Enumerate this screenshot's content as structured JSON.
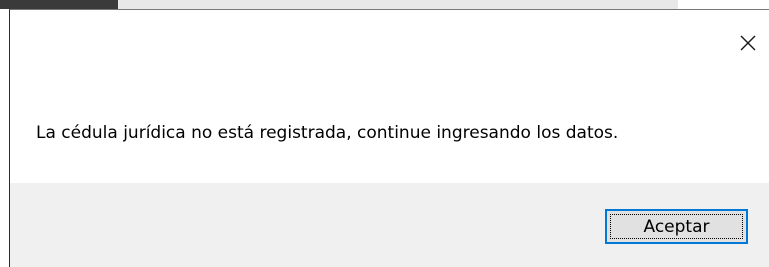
{
  "dialog": {
    "message": "La cédula jurídica no está registrada, continue ingresando los datos.",
    "close_icon": "close-icon",
    "ok_button_label": "Aceptar"
  },
  "colors": {
    "footer_background": "#f0f0f0",
    "button_background": "#e1e1e1",
    "button_focus_border": "#0078d7"
  }
}
